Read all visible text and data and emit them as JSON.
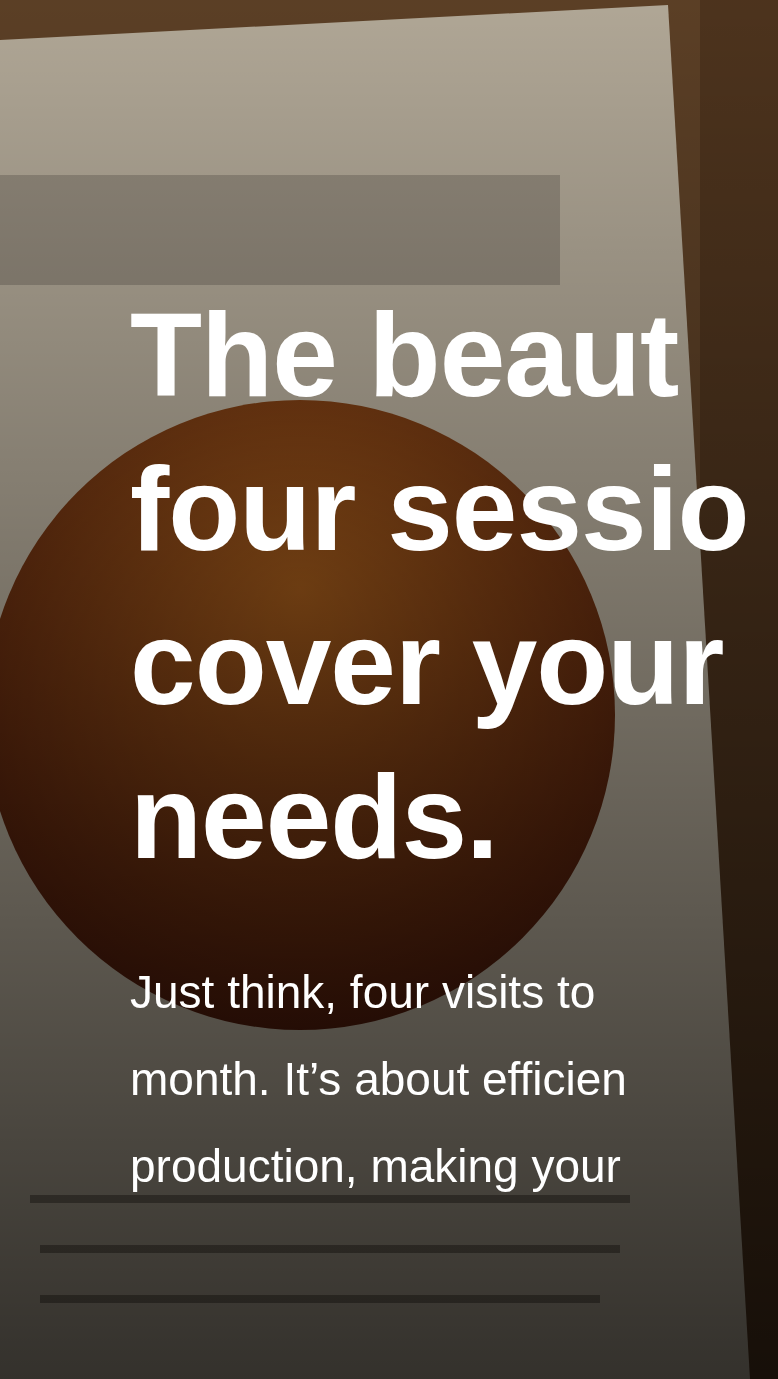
{
  "hero": {
    "background": {
      "kind": "picture"
    },
    "heading_lines": [
      "The beaut",
      "four sessio",
      "cover your",
      "needs."
    ],
    "body_lines": [
      "Just think, four visits to",
      "month. It’s about efficien",
      "production, making your"
    ]
  }
}
